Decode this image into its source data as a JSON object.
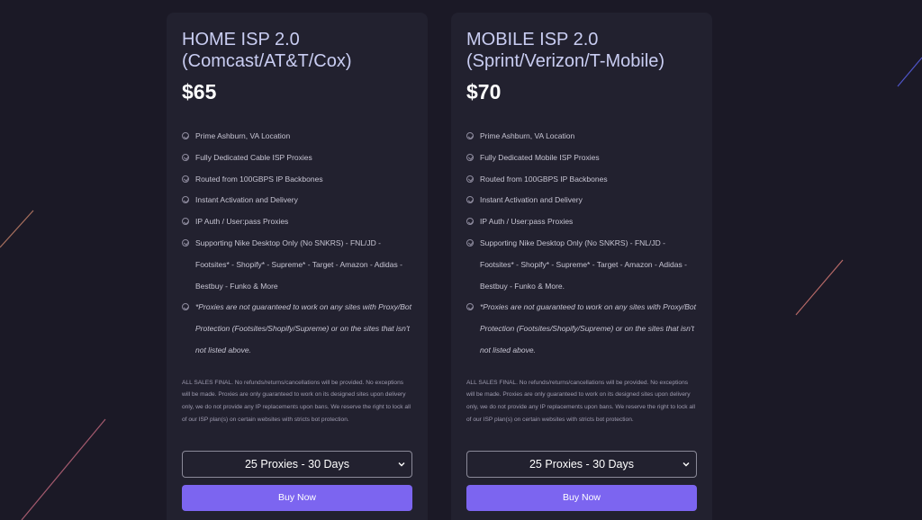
{
  "theme": {
    "background": "#1b1926",
    "card_background": "#22212f",
    "accent": "#7c65f0",
    "title_color": "#c9cdf2"
  },
  "plans": [
    {
      "title_line1": "HOME ISP 2.0",
      "title_line2": "(Comcast/AT&T/Cox)",
      "price": "$65",
      "features": [
        "Prime Ashburn, VA Location",
        "Fully Dedicated Cable ISP Proxies",
        "Routed from 100GBPS IP Backbones",
        "Instant Activation and Delivery",
        "IP Auth / User:pass Proxies",
        "Supporting Nike Desktop Only (No SNKRS) - FNL/JD - Footsites* - Shopify* - Supreme* - Target - Amazon - Adidas - Bestbuy - Funko & More",
        "*Proxies are not guaranteed to work on any sites with Proxy/Bot Protection (Footsites/Shopify/Supreme) or on the sites that isn't not listed above."
      ],
      "disclaimer": "ALL SALES FINAL. No refunds/returns/cancellations will be provided. No exceptions will be made. Proxies are only guaranteed to work on its designed sites upon delivery only, we do not provide any IP replacements upon bans. We reserve the right to lock all of our ISP plan(s) on certain websites with stricts bot protection.",
      "select_value": "25 Proxies - 30 Days",
      "buy_label": "Buy Now"
    },
    {
      "title_line1": "MOBILE ISP 2.0",
      "title_line2": "(Sprint/Verizon/T-Mobile)",
      "price": "$70",
      "features": [
        "Prime Ashburn, VA Location",
        "Fully Dedicated Mobile ISP Proxies",
        "Routed from 100GBPS IP Backbones",
        "Instant Activation and Delivery",
        "IP Auth / User:pass Proxies",
        "Supporting Nike Desktop Only (No SNKRS) - FNL/JD - Footsites* - Shopify* - Supreme* - Target - Amazon - Adidas - Bestbuy - Funko & More.",
        "*Proxies are not guaranteed to work on any sites with Proxy/Bot Protection (Footsites/Shopify/Supreme) or on the sites that isn't not listed above."
      ],
      "disclaimer": "ALL SALES FINAL. No refunds/returns/cancellations will be provided. No exceptions will be made. Proxies are only guaranteed to work on its designed sites upon delivery only, we do not provide any IP replacements upon bans. We reserve the right to lock all of our ISP plan(s) on certain websites with stricts bot protection.",
      "select_value": "25 Proxies - 30 Days",
      "buy_label": "Buy Now"
    }
  ]
}
